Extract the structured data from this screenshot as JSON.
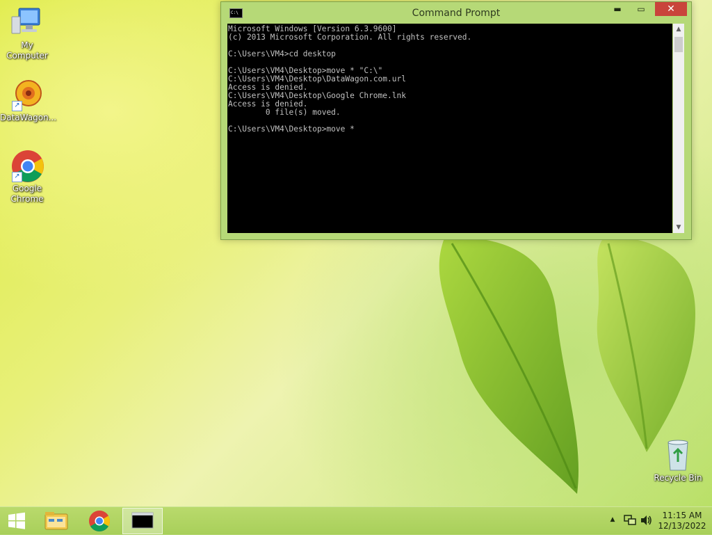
{
  "desktop": {
    "icons": [
      {
        "label": "My Computer",
        "icon": "computer-icon"
      },
      {
        "label": "DataWagon...",
        "icon": "datawagon-icon"
      },
      {
        "label": "Google Chrome",
        "icon": "chrome-icon"
      },
      {
        "label": "Recycle Bin",
        "icon": "recycle-bin-icon"
      }
    ]
  },
  "cmd_window": {
    "title": "Command Prompt",
    "minimize_glyph": "▬",
    "maximize_glyph": "▭",
    "close_glyph": "✕",
    "app_icon_text": "C:\\",
    "console_lines": "Microsoft Windows [Version 6.3.9600]\n(c) 2013 Microsoft Corporation. All rights reserved.\n\nC:\\Users\\VM4>cd desktop\n\nC:\\Users\\VM4\\Desktop>move * \"C:\\\"\nC:\\Users\\VM4\\Desktop\\DataWagon.com.url\nAccess is denied.\nC:\\Users\\VM4\\Desktop\\Google Chrome.lnk\nAccess is denied.\n        0 file(s) moved.\n\nC:\\Users\\VM4\\Desktop>move *",
    "scroll_up_glyph": "▲",
    "scroll_down_glyph": "▼"
  },
  "taskbar": {
    "tray_arrow": "▲",
    "time": "11:15 AM",
    "date": "12/13/2022",
    "cmd_icon_text": "C:\\_"
  },
  "colors": {
    "console_bg": "#000000",
    "console_text": "#c0c0c0",
    "window_frame": "#b6d977",
    "close_button": "#c9443b",
    "taskbar": "#a8cf5a"
  }
}
